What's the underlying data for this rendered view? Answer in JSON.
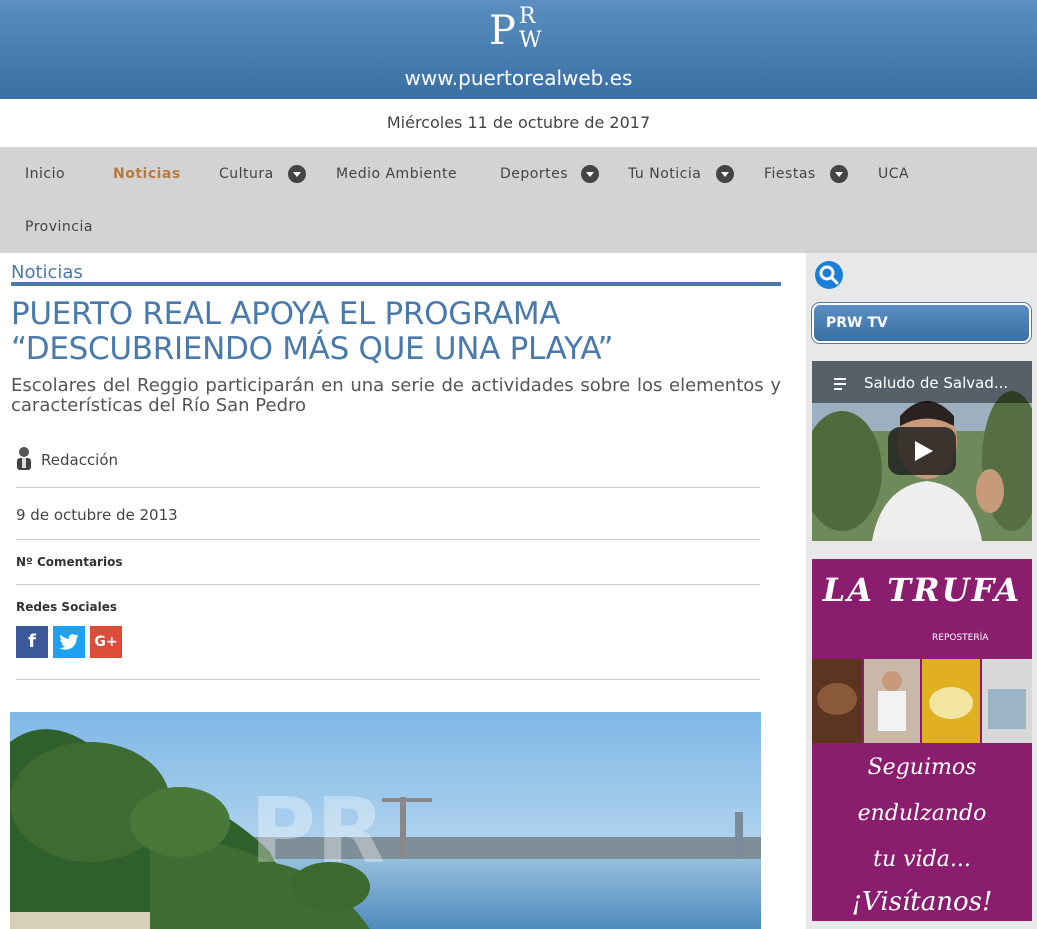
{
  "header": {
    "site_url": "www.puertorealweb.es",
    "logo_letters": [
      "P",
      "R",
      "W"
    ]
  },
  "date_bar": "Miércoles 11 de octubre de 2017",
  "nav": {
    "items": [
      {
        "label": "Inicio"
      },
      {
        "label": "Noticias",
        "active": true
      },
      {
        "label": "Cultura",
        "dropdown": true
      },
      {
        "label": "Medio Ambiente"
      },
      {
        "label": "Deportes",
        "dropdown": true
      },
      {
        "label": "Tu Noticia",
        "dropdown": true
      },
      {
        "label": "Fiestas",
        "dropdown": true
      },
      {
        "label": "UCA"
      },
      {
        "label": "Provincia"
      }
    ]
  },
  "article": {
    "section": "Noticias",
    "headline": "PUERTO REAL APOYA EL PROGRAMA “DESCUBRIENDO MÁS QUE UNA PLAYA”",
    "subtitle": "Escolares del Reggio participarán en una serie de actividades sobre los elementos y características del Río San Pedro",
    "author": "Redacción",
    "date": "9 de octubre de 2013",
    "comments_label": "Nº Comentarios",
    "social_label": "Redes Sociales",
    "social": [
      {
        "name": "facebook",
        "glyph": "f",
        "color": "#3b5998"
      },
      {
        "name": "twitter",
        "glyph": "t",
        "color": "#1da1f2"
      },
      {
        "name": "google-plus",
        "glyph": "G+",
        "color": "#dd4b39"
      }
    ]
  },
  "sidebar": {
    "prwtv_label": "PRW TV",
    "video_title": "Saludo de Salvad...",
    "ad": {
      "brand": "LA TRUFA",
      "brand_sub": "REPOSTERÍA",
      "lines": [
        "Seguimos",
        "endulzando",
        "tu vida...",
        "¡Visítanos!"
      ]
    }
  },
  "colors": {
    "accent": "#4a7aab",
    "nav_active": "#b87a3c",
    "ad_bg": "#8a1d6e"
  }
}
